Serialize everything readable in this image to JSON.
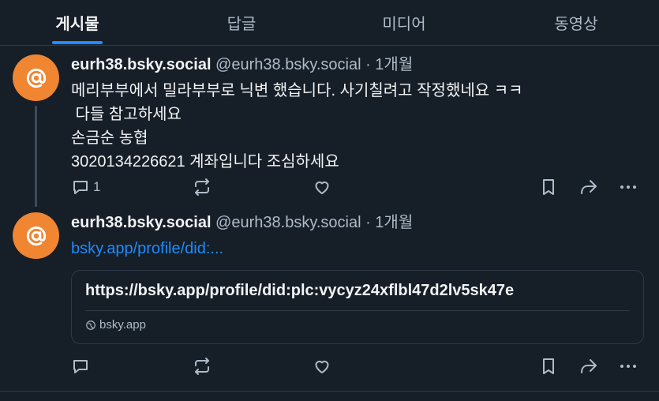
{
  "tabs": [
    {
      "label": "게시물",
      "active": true
    },
    {
      "label": "답글",
      "active": false
    },
    {
      "label": "미디어",
      "active": false
    },
    {
      "label": "동영상",
      "active": false
    }
  ],
  "colors": {
    "accent": "#208bfe",
    "avatar": "#f08532",
    "background": "#161e27"
  },
  "posts": [
    {
      "display_name": "eurh38.bsky.social",
      "handle_time": " @eurh38.bsky.social · 1개월",
      "text": "메리부부에서 밀라부부로 닉변 했습니다. 사기칠려고 작정했네요 ㅋㅋ\n 다들 참고하세요\n손금순 농협\n3020134226621 계좌입니다 조심하세요",
      "reply_count": "1"
    },
    {
      "display_name": "eurh38.bsky.social",
      "handle_time": " @eurh38.bsky.social · 1개월",
      "link_text": "bsky.app/profile/did:...",
      "embed": {
        "title": "https://bsky.app/profile/did:plc:vycyz24xflbl47d2lv5sk47e",
        "domain": "bsky.app"
      },
      "reply_count": ""
    }
  ],
  "icons": [
    "at-sign-icon",
    "reply-icon",
    "repost-icon",
    "like-icon",
    "bookmark-icon",
    "share-icon",
    "more-icon",
    "globe-icon"
  ]
}
